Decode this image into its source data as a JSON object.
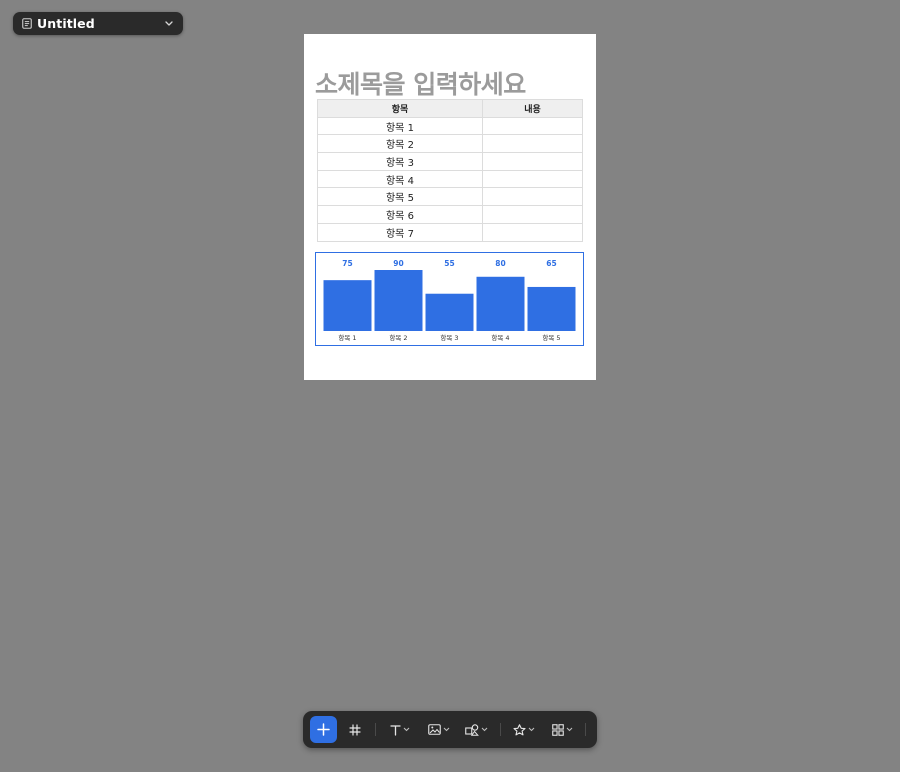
{
  "document": {
    "title": "Untitled",
    "title_icon": "document-icon",
    "dropdown_icon": "chevron-down-icon"
  },
  "page": {
    "subtitle_placeholder": "소제목을 입력하세요",
    "table": {
      "headers": [
        "항목",
        "내용"
      ],
      "rows": [
        [
          "항목 1",
          ""
        ],
        [
          "항목 2",
          ""
        ],
        [
          "항목 3",
          ""
        ],
        [
          "항목 4",
          ""
        ],
        [
          "항목 5",
          ""
        ],
        [
          "항목 6",
          ""
        ],
        [
          "항목 7",
          ""
        ]
      ]
    }
  },
  "chart_data": {
    "type": "bar",
    "categories": [
      "항목 1",
      "항목 2",
      "항목 3",
      "항목 4",
      "항목 5"
    ],
    "values": [
      75,
      90,
      55,
      80,
      65
    ],
    "bar_color": "#2f6fe3",
    "label_color": "#2f6fe3",
    "title": "",
    "xlabel": "",
    "ylabel": "",
    "ylim": [
      0,
      90
    ],
    "grid": false
  },
  "toolbar": {
    "tools": [
      {
        "name": "add",
        "icon": "plus-icon",
        "active": true
      },
      {
        "name": "frame",
        "icon": "hash-icon"
      },
      {
        "name": "text",
        "icon": "text-icon",
        "has_menu": true
      },
      {
        "name": "image",
        "icon": "image-icon",
        "has_menu": true
      },
      {
        "name": "shapes",
        "icon": "shapes-icon",
        "has_menu": true
      },
      {
        "name": "favorites",
        "icon": "star-icon",
        "has_menu": true
      },
      {
        "name": "components",
        "icon": "grid-icon",
        "has_menu": true
      }
    ],
    "accent": "#2f6fe3"
  }
}
